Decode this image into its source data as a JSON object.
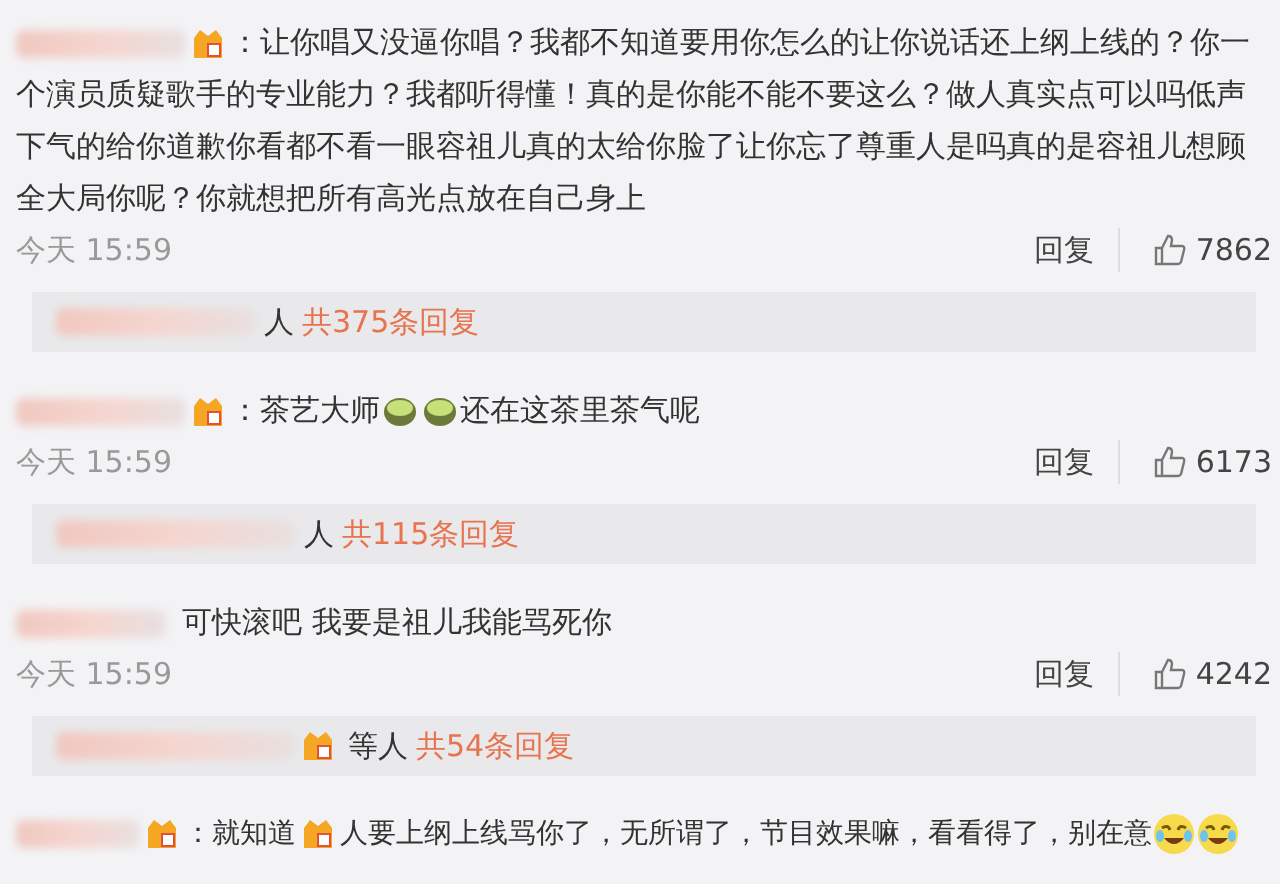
{
  "comments": [
    {
      "badge": true,
      "parts": [
        {
          "kind": "text",
          "text": "：让你唱又没逼你唱？我都不知道要用你怎么的让你说话还上纲上线的？你一个演员质疑歌手的专业能力？我都听得懂！真的是你能不能不要这么？做人真实点可以吗低声下气的给你道歉你看都不看一眼容祖儿真的太给你脸了让你忘了尊重人是吗真的是容祖儿想顾全大局你呢？你就想把所有高光点放在自己身上"
        }
      ],
      "time": "今天 15:59",
      "reply": "回复",
      "likes": "7862",
      "thread": {
        "badge": false,
        "who": "人",
        "count": "共375条回复"
      }
    },
    {
      "badge": true,
      "parts": [
        {
          "kind": "text",
          "text": "：茶艺大师"
        },
        {
          "kind": "tea"
        },
        {
          "kind": "tea"
        },
        {
          "kind": "text",
          "text": "还在这茶里茶气呢"
        }
      ],
      "time": "今天 15:59",
      "reply": "回复",
      "likes": "6173",
      "thread": {
        "badge": false,
        "who": "人",
        "count": "共115条回复"
      }
    },
    {
      "badge": false,
      "parts": [
        {
          "kind": "text",
          "text": "可快滚吧 我要是祖儿我能骂死你"
        }
      ],
      "time": "今天 15:59",
      "reply": "回复",
      "likes": "4242",
      "thread": {
        "badge": true,
        "who": "等人",
        "count": "共54条回复"
      }
    },
    {
      "badge": true,
      "parts": [
        {
          "kind": "text",
          "text": "：就知道"
        },
        {
          "kind": "badge"
        },
        {
          "kind": "text",
          "text": "人要上纲上线骂你了，无所谓了，节目效果嘛，看看得了，别在意"
        },
        {
          "kind": "laugh"
        },
        {
          "kind": "laugh"
        }
      ]
    }
  ]
}
